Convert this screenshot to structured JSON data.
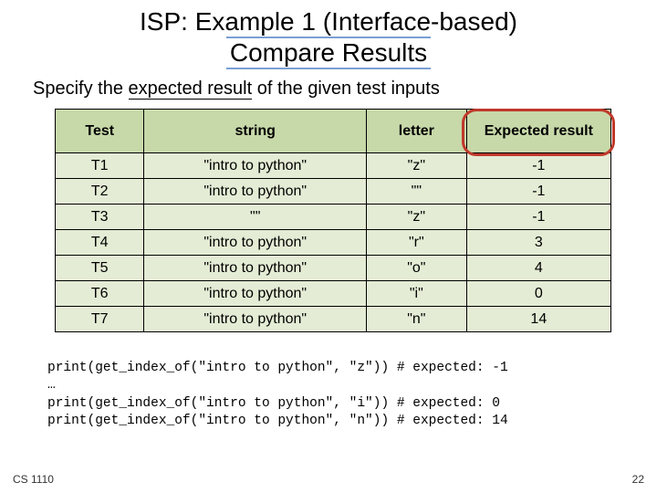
{
  "title_line1": "ISP: Example 1 (Interface-based)",
  "title_line2": "Compare Results",
  "subtitle_prefix": "Specify the ",
  "subtitle_underline": "expected result",
  "subtitle_suffix": " of the given test inputs",
  "columns": [
    "Test",
    "string",
    "letter",
    "Expected result"
  ],
  "rows": [
    {
      "test": "T1",
      "string": "\"intro to python\"",
      "letter": "\"z\"",
      "expected": "-1"
    },
    {
      "test": "T2",
      "string": "\"intro to python\"",
      "letter": "\"\"",
      "expected": "-1"
    },
    {
      "test": "T3",
      "string": "\"\"",
      "letter": "\"z\"",
      "expected": "-1"
    },
    {
      "test": "T4",
      "string": "\"intro to python\"",
      "letter": "\"r\"",
      "expected": "3"
    },
    {
      "test": "T5",
      "string": "\"intro to python\"",
      "letter": "\"o\"",
      "expected": "4"
    },
    {
      "test": "T6",
      "string": "\"intro to python\"",
      "letter": "\"i\"",
      "expected": "0"
    },
    {
      "test": "T7",
      "string": "\"intro to python\"",
      "letter": "\"n\"",
      "expected": "14"
    }
  ],
  "code_lines": [
    "print(get_index_of(\"intro to python\", \"z\")) # expected: -1",
    "…",
    "print(get_index_of(\"intro to python\", \"i\")) # expected: 0",
    "print(get_index_of(\"intro to python\", \"n\")) # expected: 14"
  ],
  "footer_left": "CS 1110",
  "footer_right": "22"
}
